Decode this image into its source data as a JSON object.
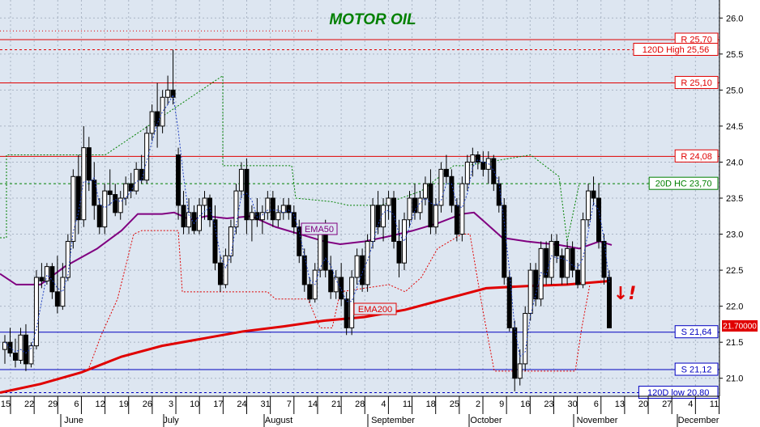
{
  "chart_data": {
    "type": "candlestick",
    "title": "MOTOR OIL",
    "ylim": [
      20.75,
      26.25
    ],
    "y_ticks": [
      "21.0",
      "21.5",
      "22.0",
      "22.5",
      "23.0",
      "23.5",
      "24.0",
      "24.5",
      "25.0",
      "25.5",
      "26.0"
    ],
    "x_day_labels": [
      "15",
      "22",
      "29",
      "6",
      "12",
      "19",
      "26",
      "3",
      "10",
      "17",
      "24",
      "31",
      "7",
      "14",
      "21",
      "28",
      "4",
      "11",
      "18",
      "25",
      "2",
      "9",
      "16",
      "23",
      "30",
      "6",
      "13",
      "20",
      "27",
      "4",
      "11"
    ],
    "x_month_labels": [
      "June",
      "July",
      "August",
      "September",
      "October",
      "November",
      "December"
    ],
    "last_price": "21.70000",
    "signal_marker": "↓!",
    "levels": [
      {
        "label": "R 25,70",
        "value": 25.7,
        "color": "#e00000",
        "style": "solid"
      },
      {
        "label": "120D High 25,56",
        "value": 25.56,
        "color": "#e00000",
        "style": "dashed"
      },
      {
        "label": "R 25,10",
        "value": 25.1,
        "color": "#e00000",
        "style": "solid"
      },
      {
        "label": "R 24,08",
        "value": 24.08,
        "color": "#e00000",
        "style": "solid"
      },
      {
        "label": "20D HC 23,70",
        "value": 23.7,
        "color": "#008000",
        "style": "dashed"
      },
      {
        "label": "S 21,64",
        "value": 21.64,
        "color": "#0000c0",
        "style": "solid"
      },
      {
        "label": "S 21,12",
        "value": 21.12,
        "color": "#0000c0",
        "style": "solid"
      },
      {
        "label": "120D low 20,80",
        "value": 20.8,
        "color": "#0000c0",
        "style": "dashed"
      }
    ],
    "series": [
      {
        "name": "EMA50",
        "color": "#800080",
        "values": [
          [
            0,
            22.45
          ],
          [
            20,
            22.3
          ],
          [
            50,
            22.3
          ],
          [
            80,
            22.55
          ],
          [
            120,
            22.8
          ],
          [
            150,
            23.05
          ],
          [
            170,
            23.28
          ],
          [
            200,
            23.28
          ],
          [
            215,
            23.3
          ],
          [
            235,
            23.2
          ],
          [
            255,
            23.25
          ],
          [
            280,
            23.22
          ],
          [
            310,
            23.25
          ],
          [
            340,
            23.1
          ],
          [
            370,
            23.0
          ],
          [
            400,
            22.9
          ],
          [
            420,
            22.86
          ],
          [
            450,
            22.9
          ],
          [
            480,
            22.97
          ],
          [
            510,
            23.05
          ],
          [
            540,
            23.15
          ],
          [
            570,
            23.28
          ],
          [
            585,
            23.3
          ],
          [
            600,
            23.15
          ],
          [
            620,
            22.95
          ],
          [
            650,
            22.9
          ],
          [
            690,
            22.85
          ],
          [
            715,
            22.8
          ],
          [
            740,
            22.9
          ],
          [
            755,
            22.85
          ]
        ]
      },
      {
        "name": "EMA200",
        "color": "#e00000",
        "values": [
          [
            0,
            20.8
          ],
          [
            50,
            20.92
          ],
          [
            100,
            21.08
          ],
          [
            150,
            21.3
          ],
          [
            200,
            21.45
          ],
          [
            250,
            21.55
          ],
          [
            300,
            21.65
          ],
          [
            350,
            21.72
          ],
          [
            400,
            21.8
          ],
          [
            450,
            21.85
          ],
          [
            500,
            21.95
          ],
          [
            550,
            22.1
          ],
          [
            600,
            22.25
          ],
          [
            650,
            22.28
          ],
          [
            700,
            22.3
          ],
          [
            752,
            22.35
          ]
        ]
      }
    ],
    "candles_ohlc": [
      [
        21.4,
        21.6,
        21.2,
        21.5
      ],
      [
        21.5,
        21.7,
        21.3,
        21.35
      ],
      [
        21.35,
        21.55,
        21.15,
        21.25
      ],
      [
        21.25,
        21.7,
        21.2,
        21.6
      ],
      [
        21.6,
        21.75,
        21.1,
        21.2
      ],
      [
        21.2,
        21.5,
        21.15,
        21.45
      ],
      [
        21.45,
        22.5,
        21.4,
        22.4
      ],
      [
        22.4,
        22.6,
        22.25,
        22.35
      ],
      [
        22.35,
        22.6,
        22.3,
        22.55
      ],
      [
        22.55,
        22.6,
        22.1,
        22.2
      ],
      [
        22.2,
        22.7,
        21.9,
        22.0
      ],
      [
        22.0,
        22.6,
        21.95,
        22.4
      ],
      [
        22.4,
        23.0,
        22.35,
        22.9
      ],
      [
        22.9,
        23.9,
        22.8,
        23.8
      ],
      [
        23.8,
        24.1,
        23.0,
        23.2
      ],
      [
        23.2,
        24.5,
        23.1,
        24.2
      ],
      [
        24.2,
        24.35,
        23.6,
        23.75
      ],
      [
        23.75,
        24.0,
        23.2,
        23.4
      ],
      [
        23.4,
        23.5,
        23.0,
        23.1
      ],
      [
        23.1,
        23.7,
        23.0,
        23.6
      ],
      [
        23.6,
        23.9,
        23.4,
        23.55
      ],
      [
        23.55,
        23.7,
        23.25,
        23.3
      ],
      [
        23.3,
        23.6,
        23.2,
        23.5
      ],
      [
        23.5,
        23.8,
        23.4,
        23.7
      ],
      [
        23.7,
        23.85,
        23.5,
        23.6
      ],
      [
        23.6,
        24.0,
        23.55,
        23.9
      ],
      [
        23.9,
        24.1,
        23.7,
        23.75
      ],
      [
        23.75,
        24.5,
        23.7,
        24.4
      ],
      [
        24.4,
        24.8,
        24.3,
        24.7
      ],
      [
        24.7,
        25.1,
        24.2,
        24.5
      ],
      [
        24.5,
        25.0,
        24.4,
        24.9
      ],
      [
        24.9,
        25.2,
        24.8,
        25.0
      ],
      [
        25.0,
        25.56,
        24.8,
        24.9
      ],
      [
        24.1,
        24.2,
        23.2,
        23.4
      ],
      [
        23.4,
        23.6,
        23.0,
        23.1
      ],
      [
        23.1,
        23.5,
        23.0,
        23.3
      ],
      [
        23.3,
        23.4,
        23.0,
        23.05
      ],
      [
        23.05,
        23.5,
        23.0,
        23.4
      ],
      [
        23.4,
        23.6,
        23.2,
        23.5
      ],
      [
        23.5,
        23.55,
        23.1,
        23.2
      ],
      [
        23.2,
        23.4,
        22.5,
        22.6
      ],
      [
        22.6,
        22.7,
        22.2,
        22.3
      ],
      [
        22.3,
        22.8,
        22.25,
        22.7
      ],
      [
        22.7,
        23.2,
        22.6,
        23.1
      ],
      [
        23.1,
        23.7,
        23.0,
        23.6
      ],
      [
        23.6,
        24.0,
        23.5,
        23.9
      ],
      [
        23.9,
        24.05,
        23.0,
        23.2
      ],
      [
        23.2,
        23.4,
        22.9,
        23.3
      ],
      [
        23.3,
        23.5,
        23.1,
        23.2
      ],
      [
        23.2,
        23.4,
        23.0,
        23.3
      ],
      [
        23.3,
        23.6,
        23.2,
        23.5
      ],
      [
        23.5,
        23.6,
        23.1,
        23.2
      ],
      [
        23.2,
        23.4,
        23.1,
        23.3
      ],
      [
        23.3,
        23.5,
        23.2,
        23.4
      ],
      [
        23.4,
        23.5,
        23.2,
        23.3
      ],
      [
        23.3,
        23.4,
        23.0,
        23.1
      ],
      [
        23.1,
        23.2,
        22.6,
        22.7
      ],
      [
        22.7,
        22.8,
        22.2,
        22.3
      ],
      [
        22.3,
        22.4,
        22.05,
        22.1
      ],
      [
        22.1,
        22.6,
        22.05,
        22.5
      ],
      [
        22.5,
        23.1,
        22.4,
        23.0
      ],
      [
        23.0,
        23.2,
        22.4,
        22.5
      ],
      [
        22.5,
        22.7,
        22.1,
        22.2
      ],
      [
        22.2,
        22.5,
        22.1,
        22.4
      ],
      [
        22.4,
        22.6,
        22.0,
        22.1
      ],
      [
        22.1,
        22.2,
        21.6,
        21.7
      ],
      [
        21.7,
        22.5,
        21.6,
        22.4
      ],
      [
        22.4,
        22.8,
        22.3,
        22.7
      ],
      [
        22.7,
        22.8,
        22.2,
        22.3
      ],
      [
        22.3,
        23.0,
        22.2,
        22.9
      ],
      [
        22.9,
        23.5,
        22.8,
        23.4
      ],
      [
        23.4,
        23.6,
        23.0,
        23.1
      ],
      [
        23.1,
        23.5,
        22.9,
        23.4
      ],
      [
        23.4,
        23.6,
        23.2,
        23.5
      ],
      [
        23.5,
        23.6,
        22.8,
        22.9
      ],
      [
        22.9,
        23.2,
        22.4,
        22.6
      ],
      [
        22.6,
        23.3,
        22.5,
        23.2
      ],
      [
        23.2,
        23.6,
        23.1,
        23.5
      ],
      [
        23.5,
        23.7,
        23.2,
        23.3
      ],
      [
        23.3,
        23.6,
        23.2,
        23.5
      ],
      [
        23.5,
        23.8,
        23.4,
        23.7
      ],
      [
        23.7,
        23.9,
        23.0,
        23.1
      ],
      [
        23.1,
        23.5,
        23.0,
        23.4
      ],
      [
        23.4,
        24.0,
        23.3,
        23.9
      ],
      [
        23.9,
        24.1,
        23.7,
        23.8
      ],
      [
        23.8,
        23.9,
        23.3,
        23.4
      ],
      [
        23.4,
        23.5,
        22.9,
        23.0
      ],
      [
        23.0,
        23.8,
        22.9,
        23.7
      ],
      [
        23.7,
        24.1,
        23.6,
        24.0
      ],
      [
        24.0,
        24.2,
        23.8,
        24.1
      ],
      [
        24.1,
        24.15,
        23.9,
        24.0
      ],
      [
        24.0,
        24.15,
        23.8,
        23.9
      ],
      [
        23.9,
        24.15,
        23.7,
        24.05
      ],
      [
        24.05,
        24.1,
        23.6,
        23.7
      ],
      [
        23.7,
        23.8,
        23.3,
        23.4
      ],
      [
        23.4,
        23.5,
        22.3,
        22.4
      ],
      [
        22.4,
        22.5,
        21.65,
        21.7
      ],
      [
        21.7,
        21.8,
        20.82,
        21.0
      ],
      [
        21.0,
        21.4,
        20.9,
        21.2
      ],
      [
        21.2,
        22.0,
        21.1,
        21.9
      ],
      [
        21.9,
        22.6,
        21.8,
        22.5
      ],
      [
        22.5,
        22.6,
        22.0,
        22.1
      ],
      [
        22.1,
        22.9,
        22.0,
        22.8
      ],
      [
        22.8,
        22.9,
        22.3,
        22.4
      ],
      [
        22.4,
        23.0,
        22.3,
        22.9
      ],
      [
        22.9,
        23.0,
        22.6,
        22.7
      ],
      [
        22.7,
        22.8,
        22.3,
        22.4
      ],
      [
        22.4,
        22.9,
        22.3,
        22.8
      ],
      [
        22.8,
        22.9,
        22.4,
        22.5
      ],
      [
        22.5,
        22.6,
        22.25,
        22.3
      ],
      [
        22.3,
        23.3,
        22.25,
        23.2
      ],
      [
        23.2,
        23.7,
        23.1,
        23.6
      ],
      [
        23.6,
        23.8,
        23.4,
        23.5
      ],
      [
        23.5,
        23.7,
        22.8,
        22.9
      ],
      [
        22.9,
        23.0,
        22.3,
        22.4
      ],
      [
        22.4,
        22.5,
        21.7,
        21.7
      ]
    ]
  }
}
